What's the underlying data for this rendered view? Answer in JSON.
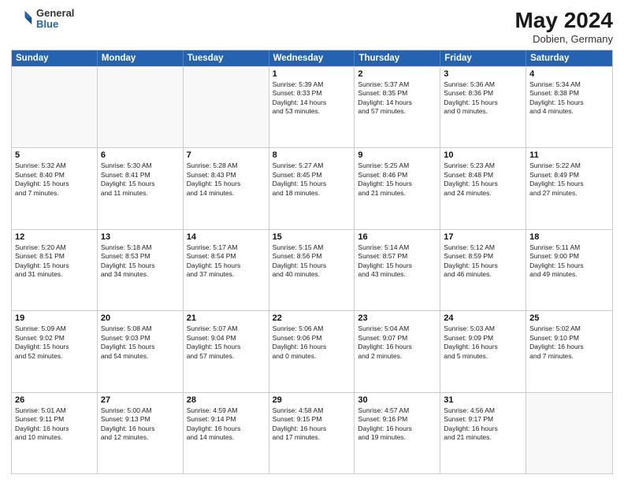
{
  "header": {
    "logo_line1": "General",
    "logo_line2": "Blue",
    "month_year": "May 2024",
    "location": "Dobien, Germany"
  },
  "weekdays": [
    "Sunday",
    "Monday",
    "Tuesday",
    "Wednesday",
    "Thursday",
    "Friday",
    "Saturday"
  ],
  "rows": [
    [
      {
        "day": "",
        "info": ""
      },
      {
        "day": "",
        "info": ""
      },
      {
        "day": "",
        "info": ""
      },
      {
        "day": "1",
        "info": "Sunrise: 5:39 AM\nSunset: 8:33 PM\nDaylight: 14 hours\nand 53 minutes."
      },
      {
        "day": "2",
        "info": "Sunrise: 5:37 AM\nSunset: 8:35 PM\nDaylight: 14 hours\nand 57 minutes."
      },
      {
        "day": "3",
        "info": "Sunrise: 5:36 AM\nSunset: 8:36 PM\nDaylight: 15 hours\nand 0 minutes."
      },
      {
        "day": "4",
        "info": "Sunrise: 5:34 AM\nSunset: 8:38 PM\nDaylight: 15 hours\nand 4 minutes."
      }
    ],
    [
      {
        "day": "5",
        "info": "Sunrise: 5:32 AM\nSunset: 8:40 PM\nDaylight: 15 hours\nand 7 minutes."
      },
      {
        "day": "6",
        "info": "Sunrise: 5:30 AM\nSunset: 8:41 PM\nDaylight: 15 hours\nand 11 minutes."
      },
      {
        "day": "7",
        "info": "Sunrise: 5:28 AM\nSunset: 8:43 PM\nDaylight: 15 hours\nand 14 minutes."
      },
      {
        "day": "8",
        "info": "Sunrise: 5:27 AM\nSunset: 8:45 PM\nDaylight: 15 hours\nand 18 minutes."
      },
      {
        "day": "9",
        "info": "Sunrise: 5:25 AM\nSunset: 8:46 PM\nDaylight: 15 hours\nand 21 minutes."
      },
      {
        "day": "10",
        "info": "Sunrise: 5:23 AM\nSunset: 8:48 PM\nDaylight: 15 hours\nand 24 minutes."
      },
      {
        "day": "11",
        "info": "Sunrise: 5:22 AM\nSunset: 8:49 PM\nDaylight: 15 hours\nand 27 minutes."
      }
    ],
    [
      {
        "day": "12",
        "info": "Sunrise: 5:20 AM\nSunset: 8:51 PM\nDaylight: 15 hours\nand 31 minutes."
      },
      {
        "day": "13",
        "info": "Sunrise: 5:18 AM\nSunset: 8:53 PM\nDaylight: 15 hours\nand 34 minutes."
      },
      {
        "day": "14",
        "info": "Sunrise: 5:17 AM\nSunset: 8:54 PM\nDaylight: 15 hours\nand 37 minutes."
      },
      {
        "day": "15",
        "info": "Sunrise: 5:15 AM\nSunset: 8:56 PM\nDaylight: 15 hours\nand 40 minutes."
      },
      {
        "day": "16",
        "info": "Sunrise: 5:14 AM\nSunset: 8:57 PM\nDaylight: 15 hours\nand 43 minutes."
      },
      {
        "day": "17",
        "info": "Sunrise: 5:12 AM\nSunset: 8:59 PM\nDaylight: 15 hours\nand 46 minutes."
      },
      {
        "day": "18",
        "info": "Sunrise: 5:11 AM\nSunset: 9:00 PM\nDaylight: 15 hours\nand 49 minutes."
      }
    ],
    [
      {
        "day": "19",
        "info": "Sunrise: 5:09 AM\nSunset: 9:02 PM\nDaylight: 15 hours\nand 52 minutes."
      },
      {
        "day": "20",
        "info": "Sunrise: 5:08 AM\nSunset: 9:03 PM\nDaylight: 15 hours\nand 54 minutes."
      },
      {
        "day": "21",
        "info": "Sunrise: 5:07 AM\nSunset: 9:04 PM\nDaylight: 15 hours\nand 57 minutes."
      },
      {
        "day": "22",
        "info": "Sunrise: 5:06 AM\nSunset: 9:06 PM\nDaylight: 16 hours\nand 0 minutes."
      },
      {
        "day": "23",
        "info": "Sunrise: 5:04 AM\nSunset: 9:07 PM\nDaylight: 16 hours\nand 2 minutes."
      },
      {
        "day": "24",
        "info": "Sunrise: 5:03 AM\nSunset: 9:09 PM\nDaylight: 16 hours\nand 5 minutes."
      },
      {
        "day": "25",
        "info": "Sunrise: 5:02 AM\nSunset: 9:10 PM\nDaylight: 16 hours\nand 7 minutes."
      }
    ],
    [
      {
        "day": "26",
        "info": "Sunrise: 5:01 AM\nSunset: 9:11 PM\nDaylight: 16 hours\nand 10 minutes."
      },
      {
        "day": "27",
        "info": "Sunrise: 5:00 AM\nSunset: 9:13 PM\nDaylight: 16 hours\nand 12 minutes."
      },
      {
        "day": "28",
        "info": "Sunrise: 4:59 AM\nSunset: 9:14 PM\nDaylight: 16 hours\nand 14 minutes."
      },
      {
        "day": "29",
        "info": "Sunrise: 4:58 AM\nSunset: 9:15 PM\nDaylight: 16 hours\nand 17 minutes."
      },
      {
        "day": "30",
        "info": "Sunrise: 4:57 AM\nSunset: 9:16 PM\nDaylight: 16 hours\nand 19 minutes."
      },
      {
        "day": "31",
        "info": "Sunrise: 4:56 AM\nSunset: 9:17 PM\nDaylight: 16 hours\nand 21 minutes."
      },
      {
        "day": "",
        "info": ""
      }
    ]
  ]
}
